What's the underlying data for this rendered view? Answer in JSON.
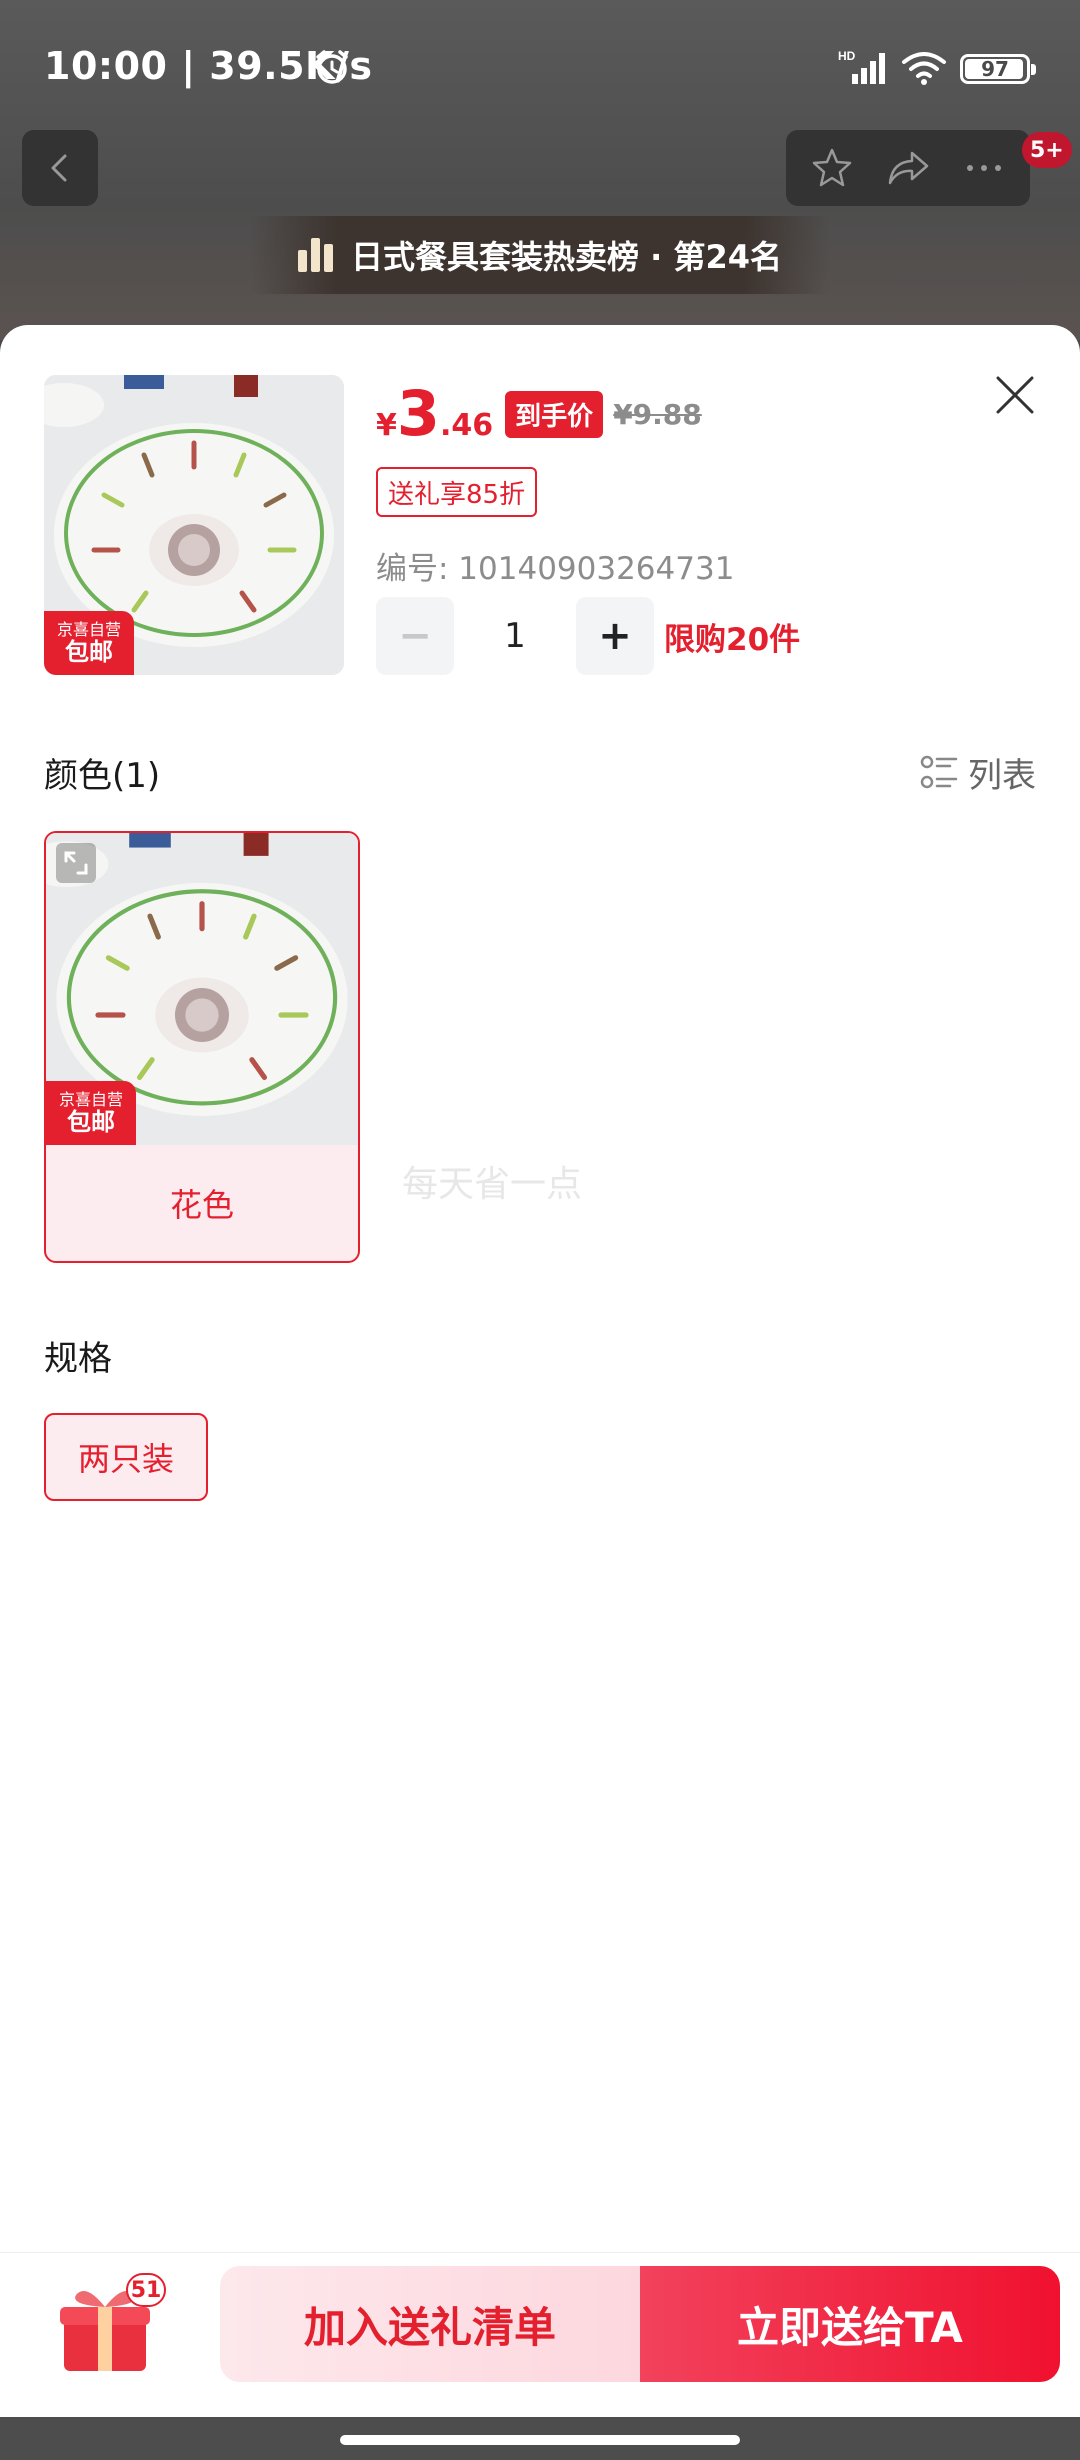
{
  "status_bar": {
    "time": "10:00 | 39.5K/s",
    "battery": "97",
    "battery_level": 0.97
  },
  "header": {
    "rank_text": "日式餐具套装热卖榜 · 第24名",
    "notification_badge": "5+"
  },
  "product": {
    "badge_line1": "京喜自营",
    "badge_line2": "包邮",
    "price_currency": "¥",
    "price_integer": "3",
    "price_decimal": ".46",
    "final_price_tag": "到手价",
    "original_price": "¥9.88",
    "gift_discount": "送礼享85折",
    "sku_number": "编号: 10140903264731",
    "quantity": "1",
    "minus": "−",
    "plus": "+",
    "purchase_limit": "限购20件"
  },
  "color_section": {
    "title": "颜色(1)",
    "list_toggle": "列表",
    "options": [
      {
        "label": "花色",
        "badge_line1": "京喜自营",
        "badge_line2": "包邮"
      }
    ]
  },
  "watermark": "每天省一点",
  "spec_section": {
    "title": "规格",
    "options": [
      "两只装"
    ]
  },
  "bottom_bar": {
    "gift_count": "51",
    "add_to_list": "加入送礼清单",
    "send_now": "立即送给TA"
  },
  "colors": {
    "accent_red": "#e4202f",
    "light_pink": "#fdecef"
  }
}
